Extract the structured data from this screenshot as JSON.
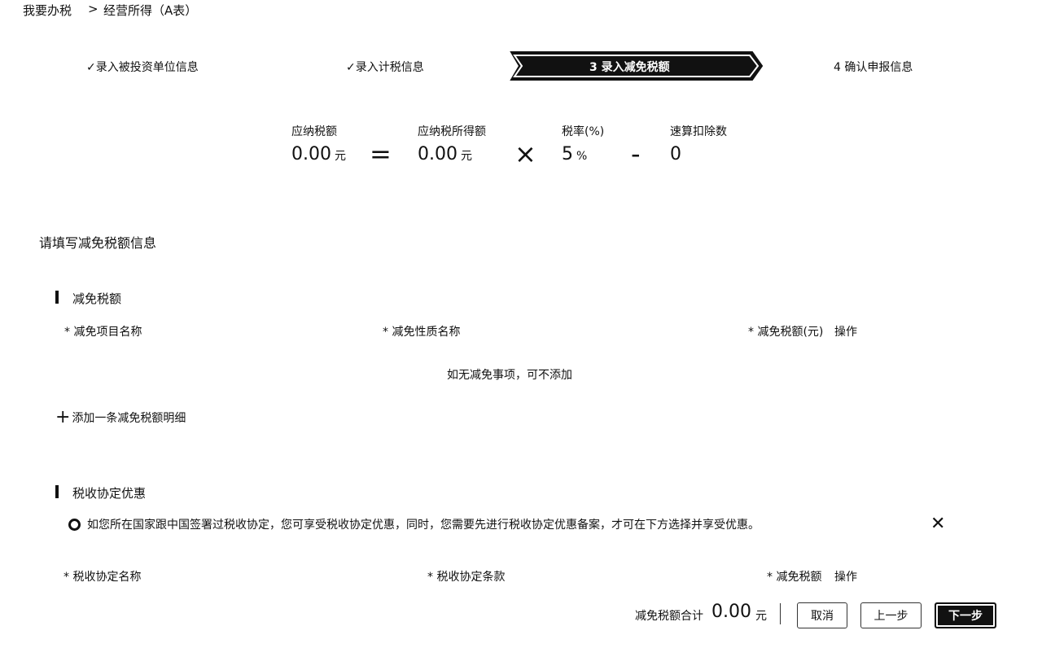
{
  "breadcrumb": {
    "home": "我要办税",
    "separator": ">",
    "current": "经营所得（A表）"
  },
  "steps": [
    {
      "label": "录入被投资单位信息",
      "done": true
    },
    {
      "label": "录入计税信息",
      "done": true
    },
    {
      "label": "3  录入减免税额",
      "active": true
    },
    {
      "label": "4  确认申报信息"
    }
  ],
  "check_glyph": "✓",
  "formula": {
    "tax_payable": {
      "label": "应纳税额",
      "value": "0.00",
      "unit": "元"
    },
    "taxable_income": {
      "label": "应纳税所得额",
      "value": "0.00",
      "unit": "元"
    },
    "tax_rate": {
      "label": "税率(%)",
      "value": "5",
      "unit": "%"
    },
    "quick_deduction": {
      "label": "速算扣除数",
      "value": "0"
    },
    "op_equals": "=",
    "op_times": "×",
    "op_minus": "-"
  },
  "section_title": "请填写减免税额信息",
  "reduction": {
    "title": "减免税额",
    "columns": [
      "* 减免项目名称",
      "* 减免性质名称",
      "* 减免税额(元)",
      "操作"
    ],
    "empty_text": "如无减免事项，可不添加",
    "add_label": "添加一条减免税额明细",
    "add_glyph": "+"
  },
  "treaty": {
    "title": "税收协定优惠",
    "notice": "如您所在国家跟中国签署过税收协定，您可享受税收协定优惠，同时，您需要先进行税收协定优惠备案，才可在下方选择并享受优惠。",
    "close_glyph": "✕",
    "columns": [
      "* 税收协定名称",
      "* 税收协定条款",
      "* 减免税额",
      "操作"
    ]
  },
  "footer": {
    "total_label": "减免税额合计",
    "total_value": "0.00",
    "total_unit": "元",
    "cancel": "取消",
    "prev": "上一步",
    "next": "下一步"
  }
}
